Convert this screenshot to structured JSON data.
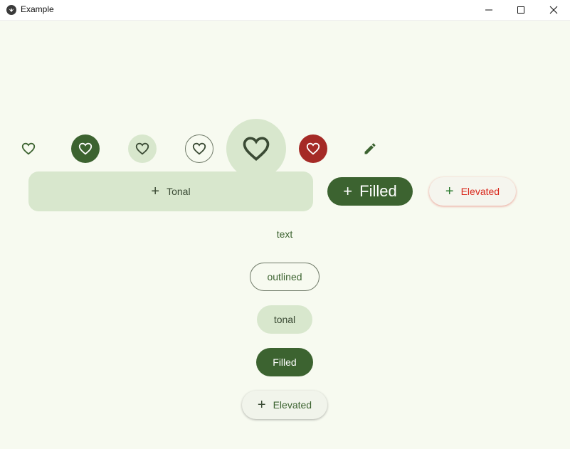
{
  "window": {
    "title": "Example",
    "controls": [
      "minimize-icon",
      "maximize-icon",
      "close-icon"
    ]
  },
  "colors": {
    "background": "#f7faf0",
    "primary": "#3c6330",
    "tonal": "#d8e7cd",
    "error": "#a52a26",
    "elevated_text_red": "#d9281c",
    "outline": "#6f7a68"
  },
  "icon_buttons": [
    {
      "variant": "standard",
      "icon": "heart-outline-icon"
    },
    {
      "variant": "filled",
      "icon": "heart-outline-icon"
    },
    {
      "variant": "tonal",
      "icon": "heart-outline-icon"
    },
    {
      "variant": "outlined",
      "icon": "heart-outline-icon"
    },
    {
      "variant": "large-tonal",
      "icon": "heart-outline-icon"
    },
    {
      "variant": "error-filled",
      "icon": "heart-outline-icon"
    },
    {
      "variant": "standard",
      "icon": "pencil-icon"
    }
  ],
  "row_buttons": {
    "tonal": "Tonal",
    "filled": "Filled",
    "elevated": "Elevated"
  },
  "column_buttons": {
    "text": "text",
    "outlined": "outlined",
    "tonal": "tonal",
    "filled": "Filled",
    "elevated": "Elevated"
  }
}
